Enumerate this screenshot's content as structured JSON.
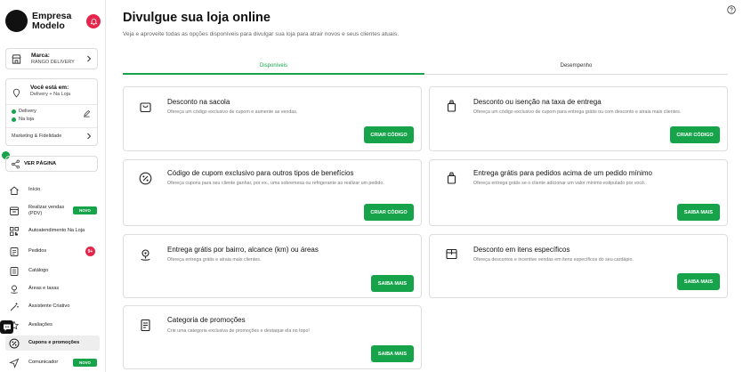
{
  "brand": {
    "name": "Empresa Modelo"
  },
  "store_card": {
    "label": "Marca:",
    "value": "RANGO DELIVERY"
  },
  "location_card": {
    "label": "Você está em:",
    "value": "Delivery + Na Loja",
    "statuses": [
      "Delivery",
      "Na loja"
    ],
    "marketing": "Marketing & Fidelidade"
  },
  "share": {
    "label": "VER PÁGINA"
  },
  "nav": [
    {
      "label": "Início",
      "icon": "home-icon"
    },
    {
      "label": "Realizar vendas (PDV)",
      "icon": "pos-icon",
      "badge": "NOVO"
    },
    {
      "label": "Autoatendimento Na Loja",
      "icon": "qr-icon"
    },
    {
      "label": "Pedidos",
      "icon": "orders-icon",
      "count": "9+"
    },
    {
      "label": "Catálogo",
      "icon": "catalog-icon"
    },
    {
      "label": "Áreas e taxas",
      "icon": "map-pin-icon"
    },
    {
      "label": "Assistente Criativo",
      "icon": "magic-wand-icon"
    },
    {
      "label": "Avaliações",
      "icon": "star-icon"
    },
    {
      "label": "Cupons e promoções",
      "icon": "percent-icon"
    },
    {
      "label": "Comunicador",
      "icon": "send-icon",
      "badge": "NOVO"
    }
  ],
  "header": {
    "title": "Divulgue sua loja online",
    "subtitle": "Veja e aproveite todas as opções disponíveis para divulgar sua loja para atrair novos e seus clientes atuais."
  },
  "tabs": [
    "Disponíveis",
    "Desempenho"
  ],
  "promos": [
    {
      "title": "Desconto na sacola",
      "desc": "Ofereça um código exclusivo de cupom e aumente as vendas.",
      "button": "CRIAR CÓDIGO"
    },
    {
      "title": "Desconto ou isenção na taxa de entrega",
      "desc": "Ofereça um código exclusivo de cupom para entrega grátis ou com desconto e atraia mais clientes.",
      "button": "CRIAR CÓDIGO"
    },
    {
      "title": "Código de cupom exclusivo para outros tipos de benefícios",
      "desc": "Ofereça cupons para seu cliente ganhar, por ex., uma sobremesa ou refrigerante ao realizar um pedido.",
      "button": "CRIAR CÓDIGO"
    },
    {
      "title": "Entrega grátis para pedidos acima de um pedido mínimo",
      "desc": "Ofereça entrega grátis se o cliente adicionar um valor mínimo estipulado por você.",
      "button": "SAIBA MAIS"
    },
    {
      "title": "Entrega grátis por bairro, alcance (km) ou áreas",
      "desc": "Ofereça entrega grátis e atraia mais clientes.",
      "button": "SAIBA MAIS"
    },
    {
      "title": "Desconto em itens específicos",
      "desc": "Ofereça descontos e incentive vendas em itens específicos do seu cardápio.",
      "button": "SAIBA MAIS"
    },
    {
      "title": "Categoria de promoções",
      "desc": "Crie uma categoria exclusiva de promoções e destaque ela no topo!",
      "button": "SAIBA MAIS"
    }
  ],
  "colors": {
    "accent": "#16a34a",
    "alert": "#e5254a"
  }
}
